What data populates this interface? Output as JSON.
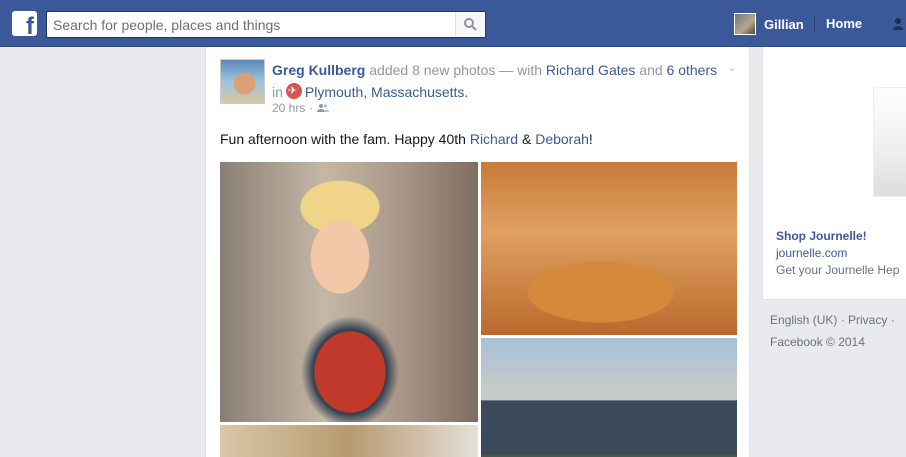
{
  "header": {
    "logo": "f",
    "search_placeholder": "Search for people, places and things",
    "profile_name": "Gillian",
    "home_label": "Home"
  },
  "post": {
    "author": "Greg Kullberg",
    "action": "added 8 new photos — with",
    "tagged": "Richard Gates",
    "and": "and",
    "others": "6 others",
    "in": "in",
    "location": "Plymouth, Massachusetts.",
    "time": "20 hrs",
    "dot": "·",
    "text_prefix": "Fun afternoon with the fam. Happy 40th",
    "mention_1": "Richard",
    "amp": "&",
    "mention_2": "Deborah",
    "text_suffix": "!"
  },
  "sidebar": {
    "ad_title": "Shop Journelle!",
    "ad_url": "journelle.com",
    "ad_desc": "Get your Journelle Hep",
    "footer_links": "English (UK) · Privacy · ",
    "footer_copy": "Facebook © 2014"
  },
  "colors": {
    "brand": "#3b5998",
    "link": "#3b5998",
    "meta": "#9197a3"
  }
}
